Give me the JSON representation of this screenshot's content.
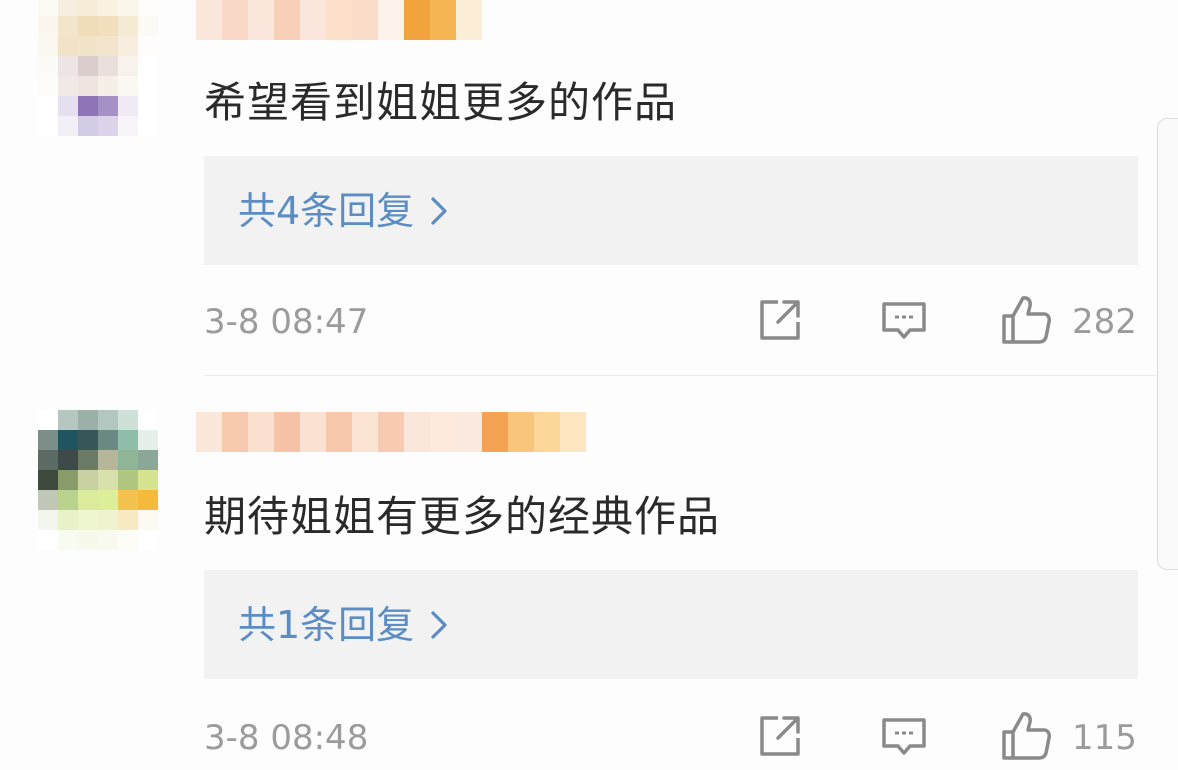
{
  "comments": [
    {
      "text": "希望看到姐姐更多的作品",
      "replies": "共4条回复",
      "time": "3-8 08:47",
      "likes": "282",
      "avatar_colors": [
        "#fdfaf3",
        "#f6eee0",
        "#f6ecd7",
        "#f9f2e0",
        "#fbf6ea",
        "#fefdfb",
        "#fbf7ee",
        "#f2e5cc",
        "#efdcb9",
        "#f1dfbd",
        "#f5ead4",
        "#fdfaf5",
        "#fbf8f2",
        "#f0e3c8",
        "#f2e4c8",
        "#f3e5cd",
        "#f7eedf",
        "#fefdfb",
        "#fcfbf8",
        "#ede5e3",
        "#dccdcd",
        "#e9e0de",
        "#f7f2ec",
        "#ffffff",
        "#fdfcf9",
        "#f0e9e5",
        "#efe5e0",
        "#f6efe7",
        "#fbf8f4",
        "#ffffff",
        "#ffffff",
        "#e5dff0",
        "#8f75b8",
        "#a591c6",
        "#efeaf4",
        "#ffffff",
        "#ffffff",
        "#f2eff7",
        "#d4cbe4",
        "#dcd3ea",
        "#f7f5fa",
        "#ffffff"
      ],
      "name_colors": [
        "#fbe7db",
        "#fbd9c8",
        "#fbe6db",
        "#f8cfb7",
        "#fbe6db",
        "#fde0c9",
        "#fbdcc8",
        "#fdf3ea",
        "#f1a33e",
        "#f6b553",
        "#fdeed7"
      ]
    },
    {
      "text": "期待姐姐有更多的经典作品",
      "replies": "共1条回复",
      "time": "3-8 08:48",
      "likes": "115",
      "avatar_colors": [
        "#ffffff",
        "#b5c7bf",
        "#9bb1a8",
        "#b4c6c0",
        "#cfe0d8",
        "#ffffff",
        "#7b8f88",
        "#1f5461",
        "#36565a",
        "#6a8a81",
        "#8fbfab",
        "#e6efe9",
        "#5b6a62",
        "#3e4a48",
        "#6b7a64",
        "#b5b69a",
        "#8fb597",
        "#8aa897",
        "#3f4a3f",
        "#8a9b6b",
        "#c9d1a2",
        "#d8e0ac",
        "#aec680",
        "#d6e48f",
        "#c1c7b7",
        "#b9d38f",
        "#d8ec9c",
        "#dcee98",
        "#f3c24f",
        "#f5b93c",
        "#f3f6ee",
        "#e7f2c9",
        "#eef6d0",
        "#eff4cf",
        "#f6e9c4",
        "#fdfaf2",
        "#ffffff",
        "#f8fbf0",
        "#f7f9eb",
        "#f8faee",
        "#fefcf7",
        "#ffffff"
      ],
      "name_colors": [
        "#fbe7db",
        "#f7c9ad",
        "#fbe0cf",
        "#f6c3a6",
        "#fbe1d1",
        "#f6c7ab",
        "#fbe3d3",
        "#f7cbb1",
        "#fbe6db",
        "#fde9dd",
        "#fbe9df",
        "#f3a153",
        "#f8c57a",
        "#fdd79a",
        "#fde6bf"
      ]
    }
  ],
  "colors": {
    "link": "#5b8dc4",
    "meta": "#9b9b9b",
    "text": "#2a2a2a",
    "reply_bg": "#f2f2f2"
  },
  "icons": {
    "share": "share-icon",
    "comment": "comment-icon",
    "like": "thumbs-up-icon",
    "chevron": "chevron-right-icon"
  }
}
